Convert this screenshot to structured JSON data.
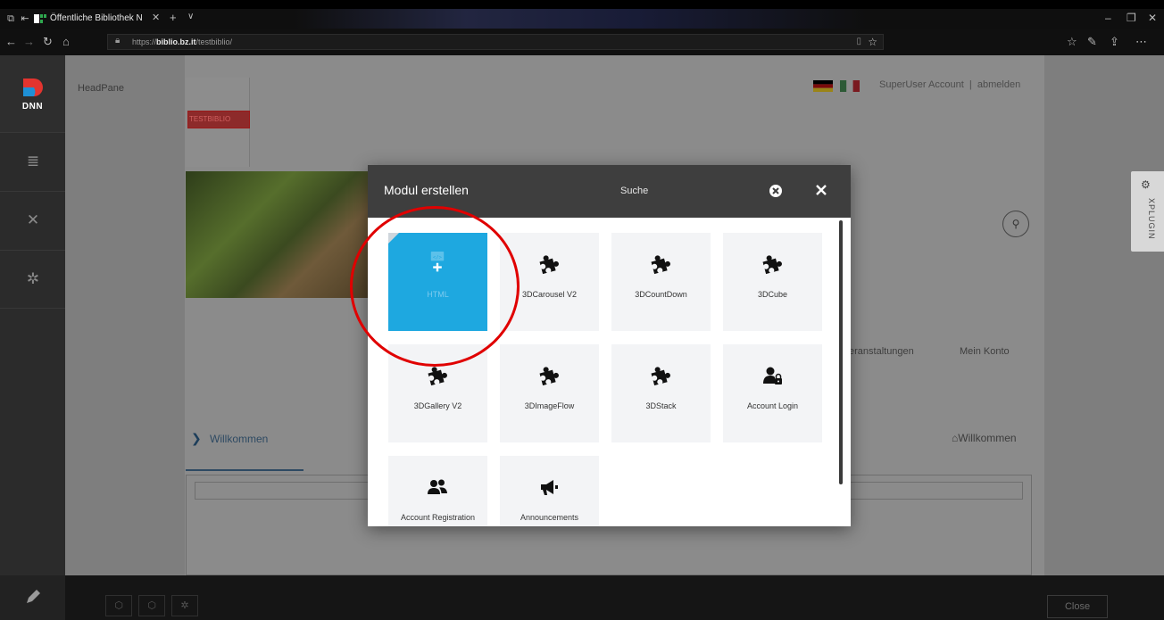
{
  "browser": {
    "tab_title": "Öffentliche Bibliothek N",
    "url_host": "https://biblio.bz.it",
    "url_path": "/testbiblio/",
    "url_prefix": "https://",
    "url_domain": "biblio.bz.it",
    "url_suffix": "/testbiblio/"
  },
  "dnn": {
    "logo_text": "DNN",
    "sidebar_items": [
      "content-icon",
      "tools-icon",
      "settings-icon"
    ]
  },
  "page": {
    "headpane_label": "HeadPane",
    "testbiblio": "TESTBIBLIO",
    "user_account": "SuperUser Account",
    "separator": "|",
    "logout": "abmelden",
    "nav_veranstaltungen": "eranstaltungen",
    "nav_meinkonto": "Mein Konto",
    "breadcrumb": "Willkommen",
    "home_link": "Willkommen",
    "xplugin": "XPLUGIN"
  },
  "bottom": {
    "close_label": "Close"
  },
  "modal": {
    "title": "Modul erstellen",
    "search_placeholder": "Suche",
    "tiles": [
      {
        "label": "HTML",
        "icon": "html-add-icon"
      },
      {
        "label": "3DCarousel V2",
        "icon": "puzzle-icon"
      },
      {
        "label": "3DCountDown",
        "icon": "puzzle-icon"
      },
      {
        "label": "3DCube",
        "icon": "puzzle-icon"
      },
      {
        "label": "3DGallery V2",
        "icon": "puzzle-icon"
      },
      {
        "label": "3DImageFlow",
        "icon": "puzzle-icon"
      },
      {
        "label": "3DStack",
        "icon": "puzzle-icon"
      },
      {
        "label": "Account Login",
        "icon": "user-lock-icon"
      },
      {
        "label": "Account Registration",
        "icon": "users-icon"
      },
      {
        "label": "Announcements",
        "icon": "megaphone-icon"
      }
    ]
  },
  "colors": {
    "accent": "#1ea8e0",
    "annotation": "#e00000",
    "modal_header": "#3e3e3e"
  }
}
